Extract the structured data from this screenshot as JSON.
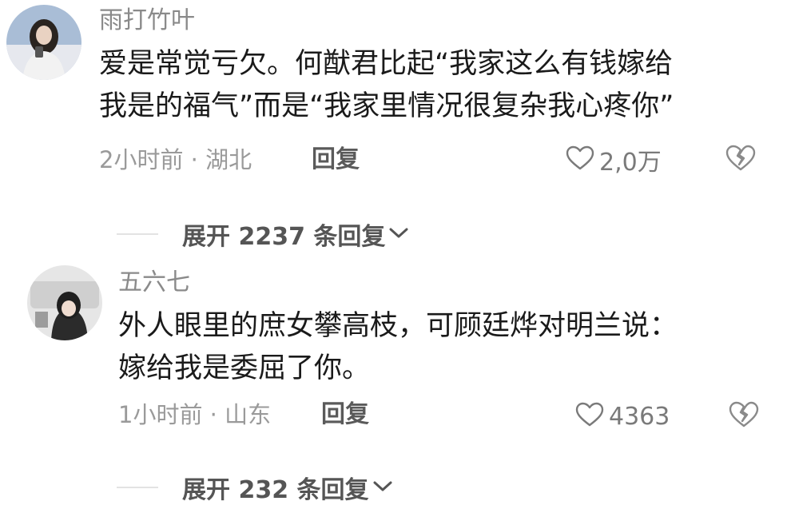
{
  "colors": {
    "username": "#8a8a8a",
    "text": "#1a1a1a",
    "meta": "#9a9a9a",
    "icon": "#7a7a7a"
  },
  "comments": [
    {
      "username": "雨打竹叶",
      "text_lines": [
        "爱是常觉亏欠。何猷君比起“我家这么有钱嫁给",
        "我是的福气”而是“我家里情况很复杂我心疼你”"
      ],
      "meta": "2小时前 · 湖北",
      "reply_label": "回复",
      "like_count": "2,0万",
      "like_icon": "heart-outline-icon",
      "dislike_icon": "broken-heart-icon",
      "expand_label": "展开 2237 条回复"
    },
    {
      "username": "五六七",
      "text_lines": [
        "外人眼里的庶女攀高枝，可顾廷烨对明兰说：",
        "嫁给我是委屈了你。"
      ],
      "meta": "1小时前 · 山东",
      "reply_label": "回复",
      "like_count": "4363",
      "like_icon": "heart-outline-icon",
      "dislike_icon": "broken-heart-icon",
      "expand_label": "展开 232 条回复"
    }
  ]
}
